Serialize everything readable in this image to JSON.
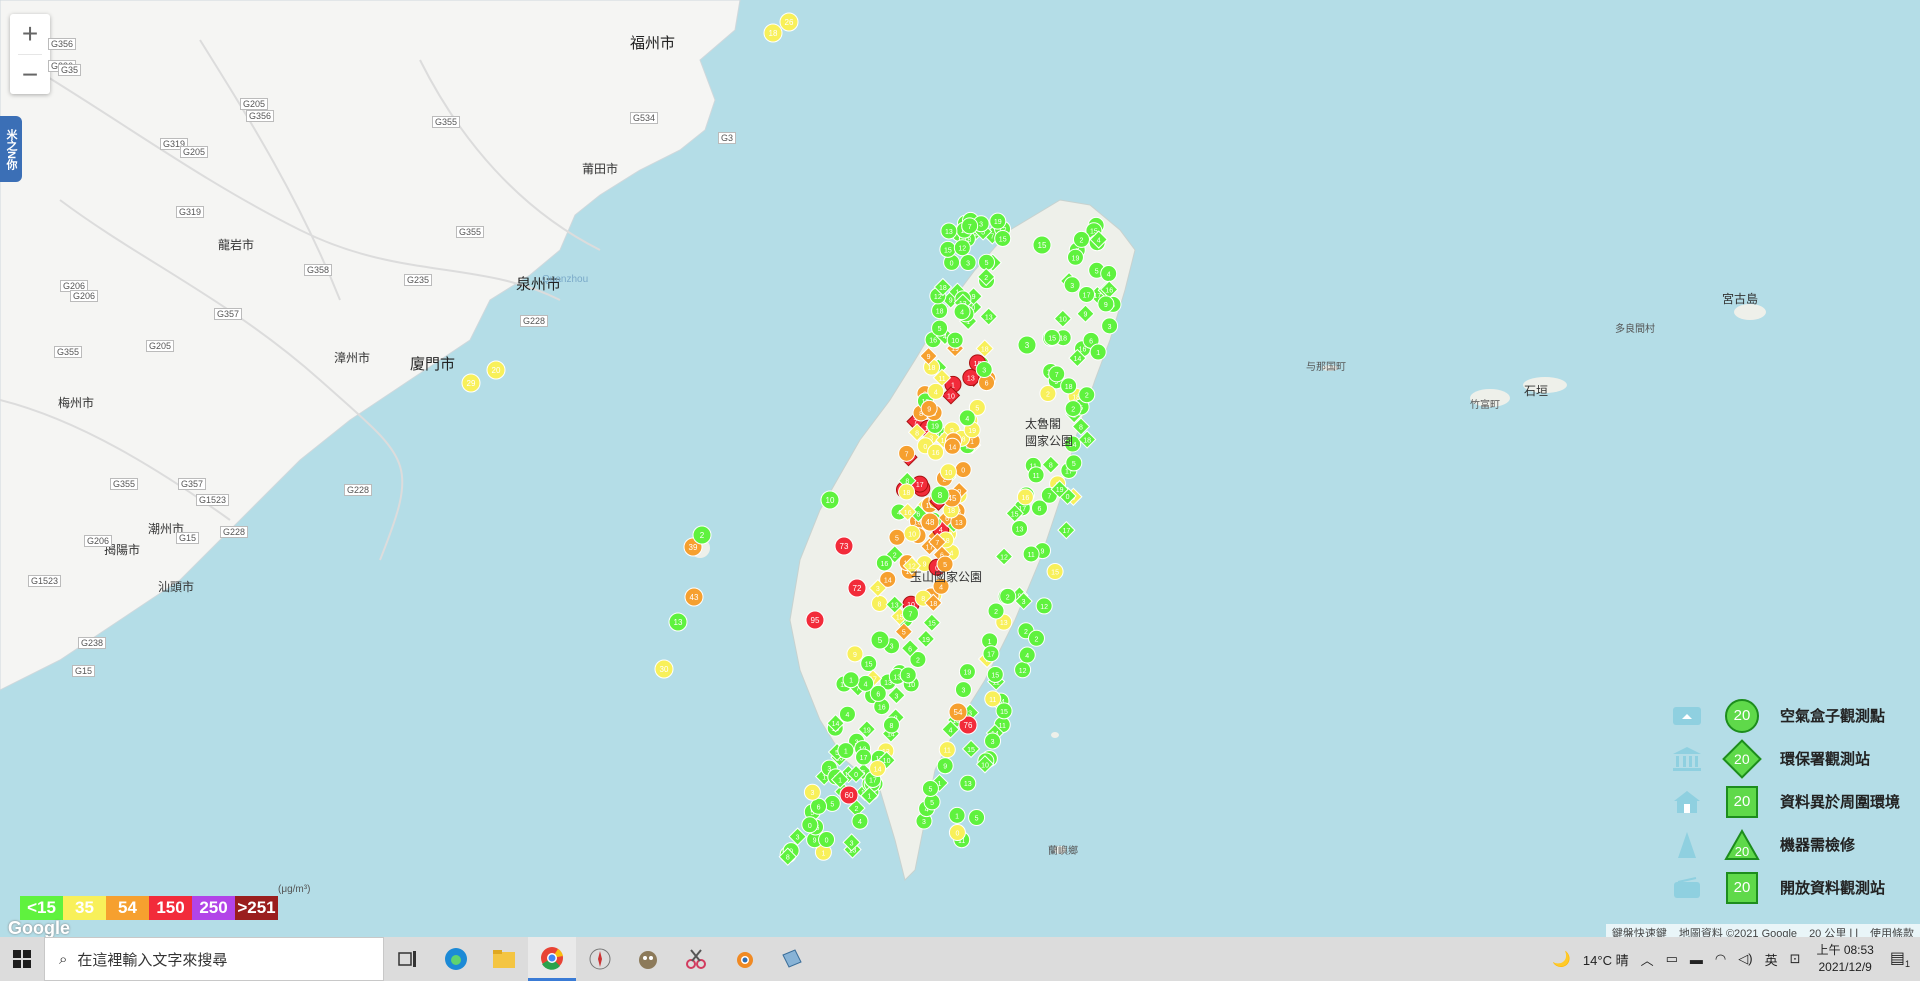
{
  "map": {
    "side_tab": "米之N你",
    "zoom_in": "+",
    "zoom_out": "−",
    "labels": [
      {
        "key": "fuzhou",
        "text": "福州市",
        "cls": "big"
      },
      {
        "key": "putian",
        "text": "莆田市",
        "cls": ""
      },
      {
        "key": "longyan",
        "text": "龍岩市",
        "cls": ""
      },
      {
        "key": "quanzhou",
        "text": "泉州市",
        "cls": "big"
      },
      {
        "key": "zhangzhou",
        "text": "漳州市",
        "cls": ""
      },
      {
        "key": "xiamen",
        "text": "廈門市",
        "cls": "big"
      },
      {
        "key": "meizhou",
        "text": "梅州市",
        "cls": ""
      },
      {
        "key": "chaozhou",
        "text": "潮州市",
        "cls": ""
      },
      {
        "key": "jieyang",
        "text": "揭陽市",
        "cls": ""
      },
      {
        "key": "shantou",
        "text": "汕頭市",
        "cls": ""
      },
      {
        "key": "miyako",
        "text": "宮古島",
        "cls": ""
      },
      {
        "key": "tarama",
        "text": "多良間村",
        "cls": "sm"
      },
      {
        "key": "yonaguni",
        "text": "与那国町",
        "cls": "sm"
      },
      {
        "key": "taketomi",
        "text": "竹富町",
        "cls": "sm"
      },
      {
        "key": "ishigaki",
        "text": "石垣",
        "cls": ""
      },
      {
        "key": "taroko",
        "text": "太魯閣\n國家公園",
        "cls": ""
      },
      {
        "key": "yushan",
        "text": "玉山國家公園",
        "cls": ""
      },
      {
        "key": "lanyu",
        "text": "蘭嶼鄉",
        "cls": "sm"
      },
      {
        "key": "quanzhou_bay",
        "text": "Quanzhou",
        "cls": "blue"
      }
    ],
    "road_labels": [
      "G356",
      "G236",
      "G35",
      "G205",
      "G319",
      "G205",
      "G356",
      "G355",
      "G534",
      "G3",
      "G319",
      "G355",
      "G358",
      "G235",
      "G357",
      "G206",
      "G355",
      "G228",
      "G205",
      "G355",
      "G357",
      "G228",
      "G1523",
      "G206",
      "G15",
      "G238",
      "G1523",
      "G15",
      "G206",
      "G228"
    ]
  },
  "pm_scale": {
    "unit": "(μg/m³)",
    "items": [
      {
        "label": "<15",
        "color": "#5ff23e"
      },
      {
        "label": "35",
        "color": "#f8f05a"
      },
      {
        "label": "54",
        "color": "#f6a02f"
      },
      {
        "label": "150",
        "color": "#f22b3a"
      },
      {
        "label": "250",
        "color": "#b244e8"
      },
      {
        "label": ">251",
        "color": "#9a1e1e"
      }
    ]
  },
  "attribution": {
    "google": "Google",
    "items": [
      "鍵盤快速鍵",
      "地圖資料 ©2021 Google",
      "20 公里 ⌊⌋",
      "使用條款"
    ]
  },
  "legend": {
    "number": "20",
    "items": [
      {
        "label": "空氣盒子觀測點",
        "icon": "airbox-icon",
        "marker": "circle"
      },
      {
        "label": "環保署觀測站",
        "icon": "museum-icon",
        "marker": "diamond"
      },
      {
        "label": "資料異於周圍環境",
        "icon": "house-icon",
        "marker": "square"
      },
      {
        "label": "機器需檢修",
        "icon": "cone-icon",
        "marker": "triangle"
      },
      {
        "label": "開放資料觀測站",
        "icon": "box-icon",
        "marker": "square"
      }
    ]
  },
  "taskbar": {
    "search_placeholder": "在這裡輸入文字來搜尋",
    "weather": "14°C 晴",
    "ime": "英",
    "time": "上午 08:53",
    "date": "2021/12/9",
    "notification_count": "1"
  },
  "markers": [
    {
      "v": 73,
      "c": "#f22b3a"
    },
    {
      "v": 95,
      "c": "#f22b3a"
    },
    {
      "v": 72,
      "c": "#f22b3a"
    },
    {
      "v": 60,
      "c": "#f22b3a"
    },
    {
      "v": 76,
      "c": "#f22b3a"
    },
    {
      "v": 48,
      "c": "#f6a02f"
    },
    {
      "v": 45,
      "c": "#f6a02f"
    },
    {
      "v": 54,
      "c": "#f6a02f"
    },
    {
      "v": 43,
      "c": "#f6a02f"
    },
    {
      "v": 39,
      "c": "#f6a02f"
    },
    {
      "v": 30,
      "c": "#f8f05a"
    },
    {
      "v": 18,
      "c": "#f8f05a"
    },
    {
      "v": 26,
      "c": "#f8f05a"
    },
    {
      "v": 29,
      "c": "#f8f05a"
    },
    {
      "v": 20,
      "c": "#f8f05a"
    },
    {
      "v": 13,
      "c": "#5ff23e"
    },
    {
      "v": 2,
      "c": "#5ff23e"
    },
    {
      "v": 8,
      "c": "#5ff23e"
    },
    {
      "v": 5,
      "c": "#5ff23e"
    },
    {
      "v": 3,
      "c": "#5ff23e"
    },
    {
      "v": 15,
      "c": "#5ff23e"
    },
    {
      "v": 10,
      "c": "#5ff23e"
    }
  ]
}
